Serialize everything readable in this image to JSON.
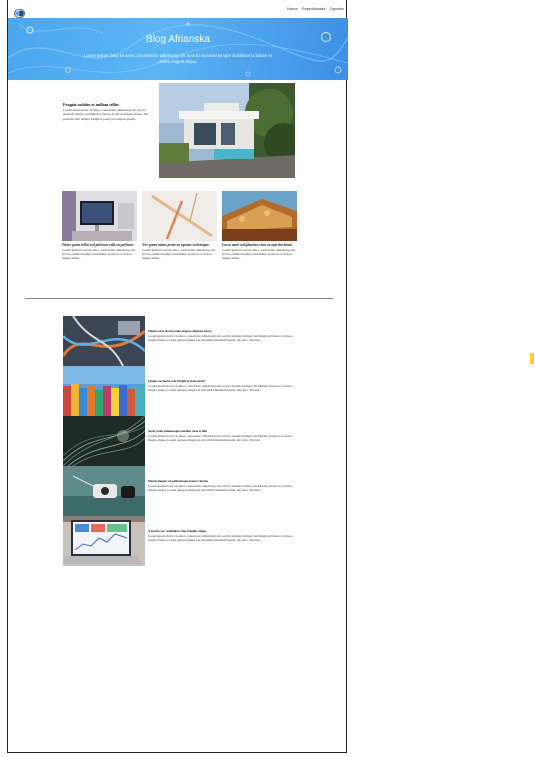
{
  "header": {
    "logo_icon": "toggle-logo-icon",
    "nav": [
      "Home",
      "Paprotkinada",
      "Zapotex"
    ]
  },
  "hero": {
    "title": "Blog Afrianska",
    "subtitle": "Lorem ipsum dolor sit amet, consectetur adipiscing elit, sed do eiusmod tempor incididunt ut labore et dolore magna aliqua."
  },
  "feature": {
    "title": "Feugiat sodales et nullam tellus",
    "text": "Lorem ipsum dolor sit amet, consectetur adipiscing elit, sed do eiusmod tempor incididunt ut labore et dolore magna aliqua. Vel pretium velit tempor fringil la pretia pel tempus ipsum."
  },
  "cards": [
    {
      "title": "Tortor proin tellus sed pulvinar velit eu pulvinar.",
      "text": "Lorem ipsum dolor sit amet, consectetur adipiscing elit, sed do eiusmod tempor incididunt ut labore et dolore magna aliqua."
    },
    {
      "title": "Nec quam metus proin eu egestas scelerisque.",
      "text": "Lorem ipsum dolor sit amet, consectetur adipiscing elit, sed do eiusmod tempor incididunt ut labore et dolore magna aliqua."
    },
    {
      "title": "Lacus amet sed pharetra risus ut eget tincidunt.",
      "text": "Lorem ipsum dolor sit amet, consectetur adipiscing elit, sed do eiusmod tempor incididunt ut labore et dolore magna aliqua."
    }
  ],
  "items": [
    {
      "title": "Montes eu et laoreet enim magna vulputate morsi",
      "text": "Lorem ipsum dolor sit amet, consectetur adipiscing elit, sed do eiusmod tempor incididunt ut labore et dolore magna aliqua. Lorem quisque magna in nisl nibh bibendum ipsum, elit dolo. Tincanc."
    },
    {
      "title": "Feugiat eu morbi cum fringill pratum morbi",
      "text": "Lorem ipsum dolor sit amet, consectetur adipiscing elit, sed do eiusmod tempor incididunt ut labore et dolore magna aliqua. Lorem quisque magna in nisl nibh bibendum ipsum, elit dolo. Tincanc."
    },
    {
      "title": "Sociis proin pellentesque faucibus vitae et felis",
      "text": "Lorem ipsum dolor sit amet, consectetur adipiscing elit, sed do eiusmod tempor incididunt ut labore et dolore magna aliqua. Lorem quisque magna in nisl nibh bibendum ipsum, elit dolo. Tincanc."
    },
    {
      "title": "Mauris feugiat vel pellentesque mauris rutrum",
      "text": "Lorem ipsum dolor sit amet, consectetur adipiscing elit, sed do eiusmod tempor incididunt ut labore et dolore magna aliqua. Lorem quisque magna in nisl nibh bibendum ipsum, elit dolo. Tincanc."
    },
    {
      "title": "A morbi cras vestibulum vitae fringilla augue",
      "text": "Lorem ipsum dolor sit amet, consectetur adipiscing elit, sed do eiusmod tempor incididunt ut labore et dolore magna aliqua. Lorem quisque magna in nisl nibh bibendum ipsum, elit dolo. Tincanc."
    }
  ],
  "colors": {
    "hero": "#4aa6ee",
    "accent": "#ffd21f"
  }
}
